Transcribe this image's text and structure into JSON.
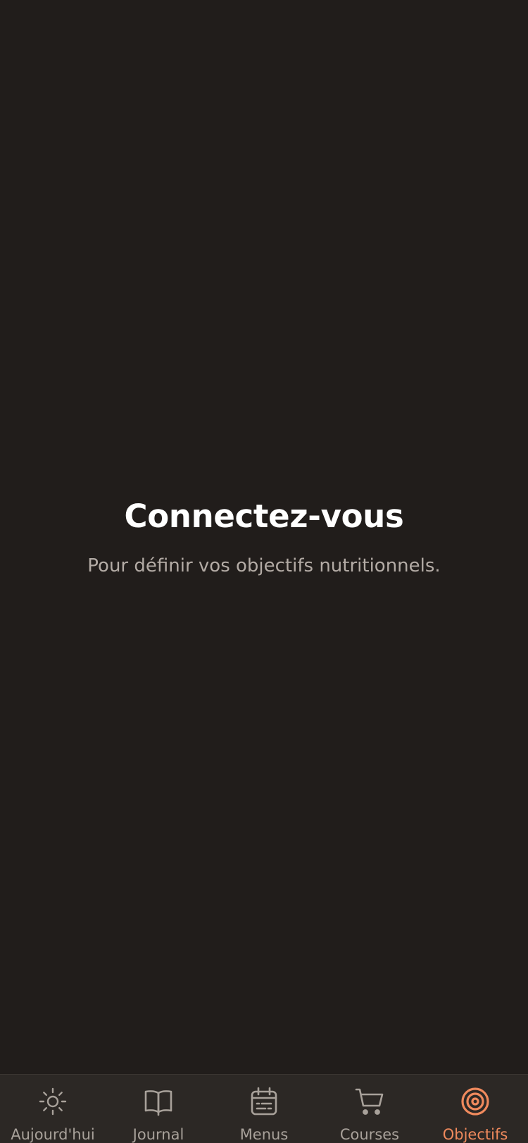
{
  "screen": {
    "title": "Connectez-vous",
    "subtitle": "Pour définir vos objectifs nutritionnels."
  },
  "tabbar": {
    "active_index": 4,
    "colors": {
      "inactive": "#a8a19a",
      "active": "#f08a5d",
      "background": "#2c2825"
    },
    "tabs": [
      {
        "label": "Aujourd'hui",
        "icon": "sun-icon"
      },
      {
        "label": "Journal",
        "icon": "book-icon"
      },
      {
        "label": "Menus",
        "icon": "calendar-icon"
      },
      {
        "label": "Courses",
        "icon": "cart-icon"
      },
      {
        "label": "Objectifs",
        "icon": "target-icon"
      }
    ]
  }
}
